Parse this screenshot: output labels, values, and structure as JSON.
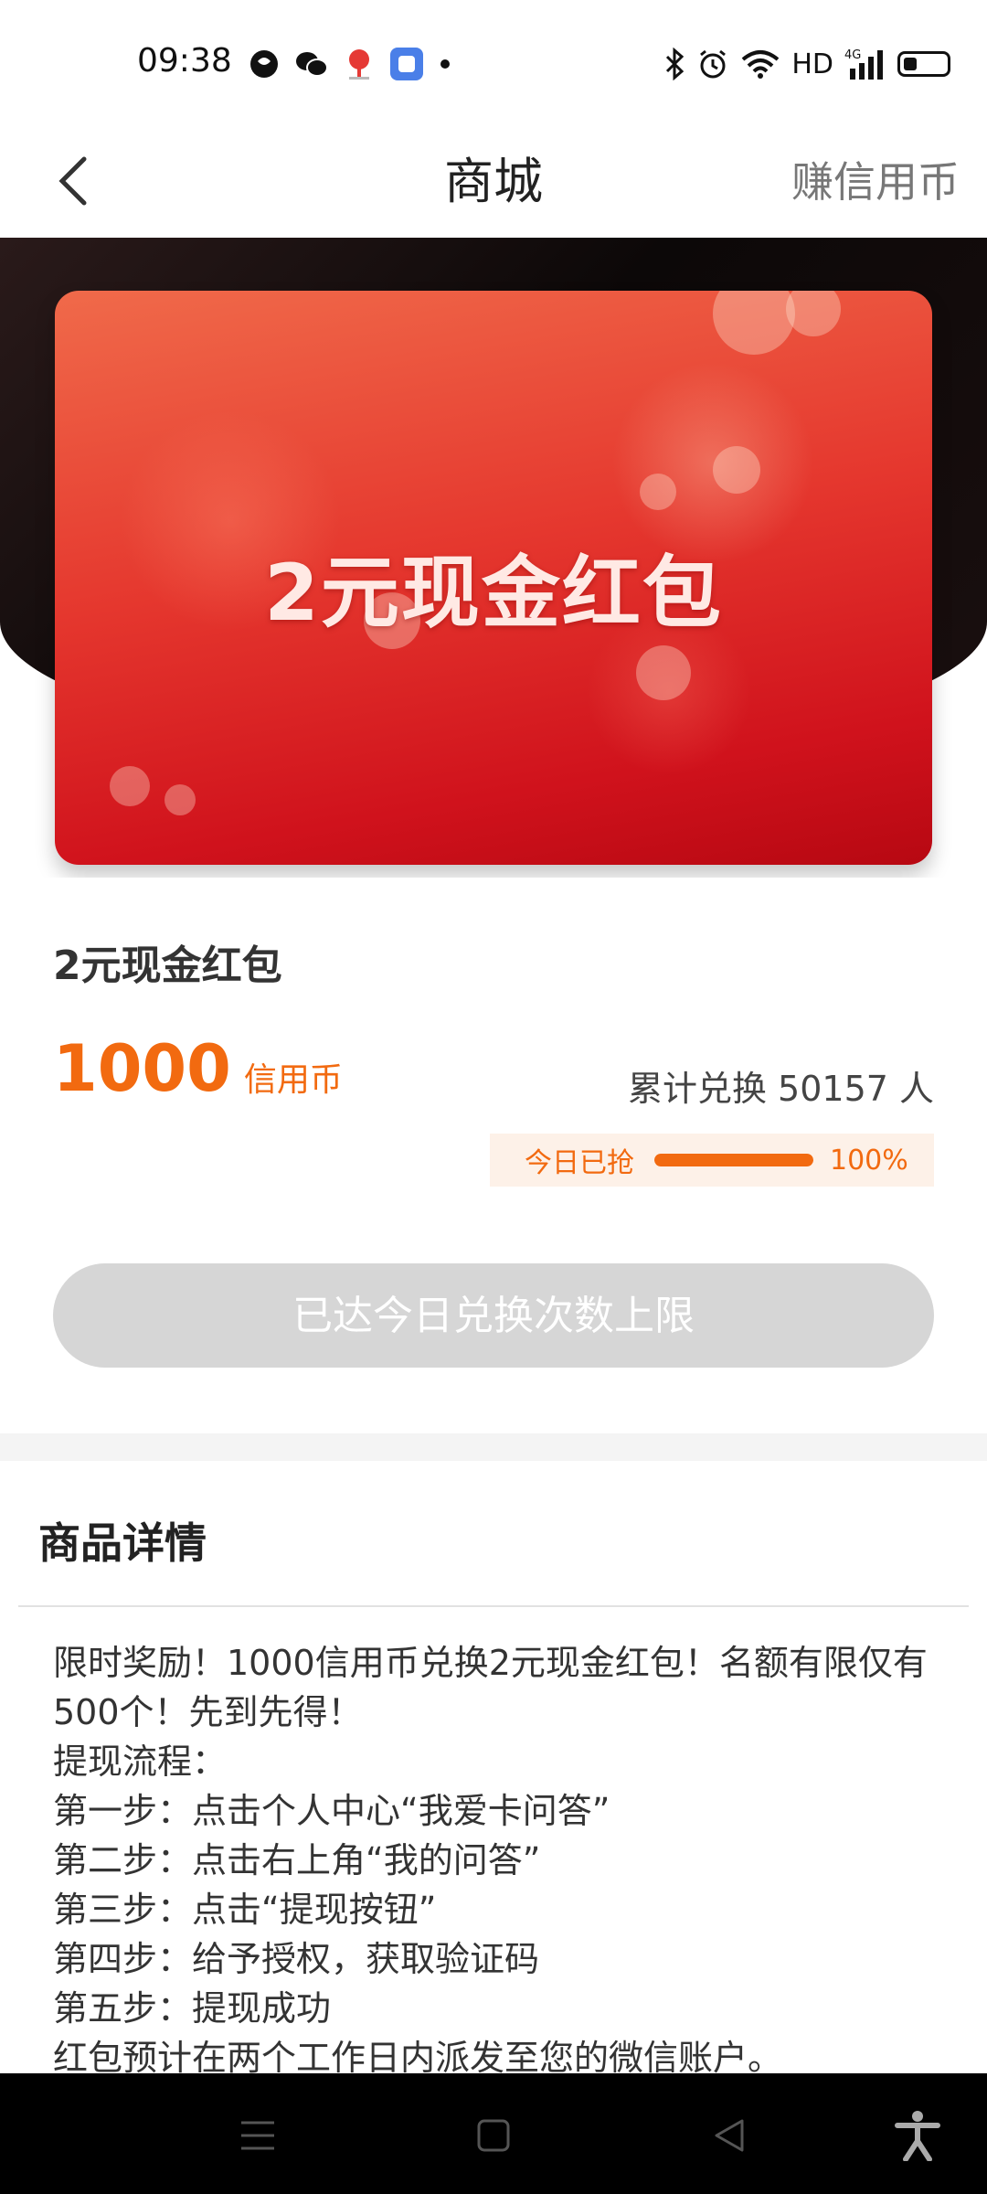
{
  "status_bar": {
    "time": "09:38",
    "network_label": "HD",
    "network_type": "4G",
    "icons_left": [
      "app-icon",
      "wechat-icon",
      "location-app-icon",
      "blue-app-icon",
      "dot-icon"
    ],
    "icons_right": [
      "bluetooth-icon",
      "alarm-icon",
      "wifi-icon",
      "signal-icon",
      "battery-icon"
    ]
  },
  "header": {
    "title": "商城",
    "right_link": "赚信用币"
  },
  "banner": {
    "card_title": "2元现金红包"
  },
  "product": {
    "name": "2元现金红包",
    "price": "1000",
    "price_unit": "信用币",
    "exchange_count": "累计兑换 50157 人",
    "progress_label": "今日已抢",
    "progress_percent": "100%",
    "progress_fraction": 1.0,
    "button_label": "已达今日兑换次数上限"
  },
  "details": {
    "title": "商品详情",
    "lines": [
      "限时奖励！1000信用币兑换2元现金红包！名额有限仅有500个！先到先得！",
      "提现流程：",
      "第一步：点击个人中心“我爱卡问答”",
      "第二步：点击右上角“我的问答”",
      "第三步：点击“提现按钮”",
      "第四步：给予授权，获取验证码",
      "第五步：提现成功",
      "红包预计在两个工作日内派发至您的微信账户。"
    ]
  },
  "nav_bar": {
    "buttons": [
      "menu-icon",
      "home-icon",
      "back-triangle-icon",
      "accessibility-icon"
    ]
  },
  "colors": {
    "accent": "#f26a10",
    "card_red": "#e5372e",
    "button_disabled": "#d6d6d6"
  }
}
